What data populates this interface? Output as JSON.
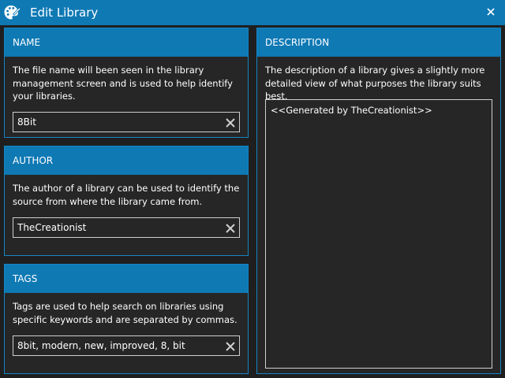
{
  "window": {
    "title": "Edit Library",
    "icon": "palette-brush-icon",
    "close_icon": "close-icon"
  },
  "name_section": {
    "header": "NAME",
    "description": "The file name will been seen in the library management screen and is used to help identify your libraries.",
    "value": "8Bit"
  },
  "author_section": {
    "header": "AUTHOR",
    "description": "The author of a library can be used to identify the source from where the library came from.",
    "value": "TheCreationist"
  },
  "tags_section": {
    "header": "TAGS",
    "description": "Tags are used to help search on libraries using specific keywords and are separated by commas.",
    "value": "8bit, modern, new, improved, 8, bit"
  },
  "description_section": {
    "header": "DESCRIPTION",
    "description": "The description of a library gives a slightly more detailed view of what purposes the library suits best.",
    "value": "<<Generated by TheCreationist>>"
  },
  "colors": {
    "accent": "#0f79b4",
    "panel_border": "#1585c4",
    "panel_background": "#262626",
    "window_background": "#1f1f1f",
    "text": "#ffffff"
  }
}
